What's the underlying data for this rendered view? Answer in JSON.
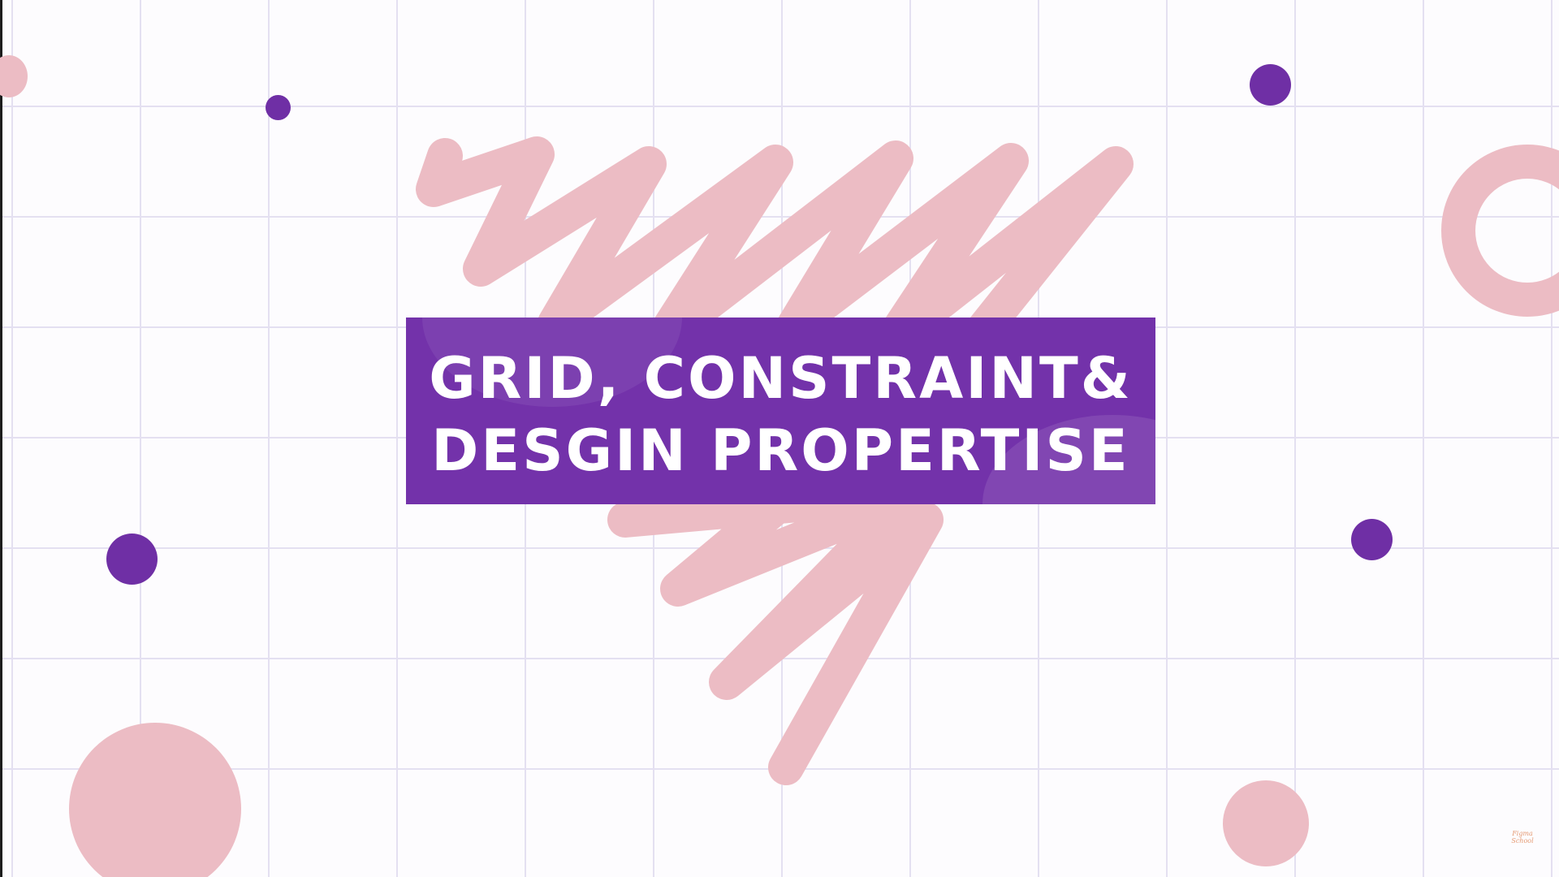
{
  "slide": {
    "title_line_1": "GRID, CONSTRAINT&",
    "title_line_2": "DESGIN PROPERTISE"
  },
  "colors": {
    "banner": "#7332aa",
    "accent_purple": "#6f2fa5",
    "accent_pink": "#ecbcc4",
    "grid_line": "#e4e0f1",
    "background": "#fdfcfe"
  },
  "watermark": {
    "text": "Figma School"
  },
  "decorations": {
    "icons": [
      "scribble-stroke",
      "ring-shape",
      "circle-dot"
    ]
  }
}
